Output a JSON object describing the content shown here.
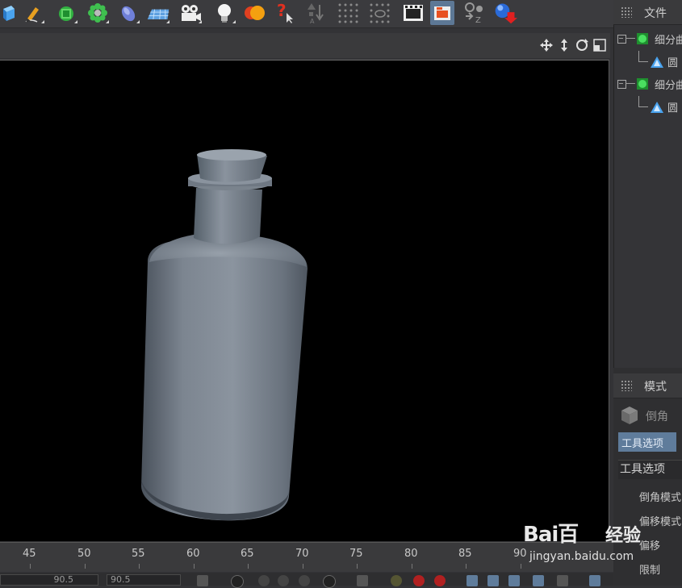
{
  "toolbar": {
    "icons": [
      "cube-icon",
      "pen-icon",
      "subdivision-icon",
      "cloner-icon",
      "deformer-icon",
      "floor-icon",
      "camera-icon",
      "light-icon",
      "material-icon",
      "help-icon",
      "spline-icon",
      "dots-icon",
      "dots-alt-icon",
      "render-view-icon",
      "render-settings-icon",
      "constraint-icon",
      "export-icon"
    ]
  },
  "objects_panel": {
    "title": "文件",
    "items": [
      {
        "label": "细分曲",
        "type": "subdivision"
      },
      {
        "label": "圆",
        "type": "object"
      },
      {
        "label": "细分曲",
        "type": "subdivision"
      },
      {
        "label": "圆",
        "type": "object"
      }
    ]
  },
  "attributes_panel": {
    "title": "模式",
    "tool_name": "倒角",
    "tab_label": "工具选项",
    "section_title": "工具选项",
    "fields": [
      "倒角模式",
      "偏移模式",
      "偏移",
      "限制"
    ]
  },
  "timeline": {
    "ticks": [
      "45",
      "50",
      "55",
      "60",
      "65",
      "70",
      "75",
      "80",
      "85",
      "90"
    ],
    "field1": "90.5",
    "field2": "90.5"
  },
  "watermark": {
    "logo": "Bai百",
    "text": "经验",
    "url": "jingyan.baidu.com"
  },
  "colors": {
    "accent": "#5f7c9b",
    "viewport_bg": "#000000"
  }
}
